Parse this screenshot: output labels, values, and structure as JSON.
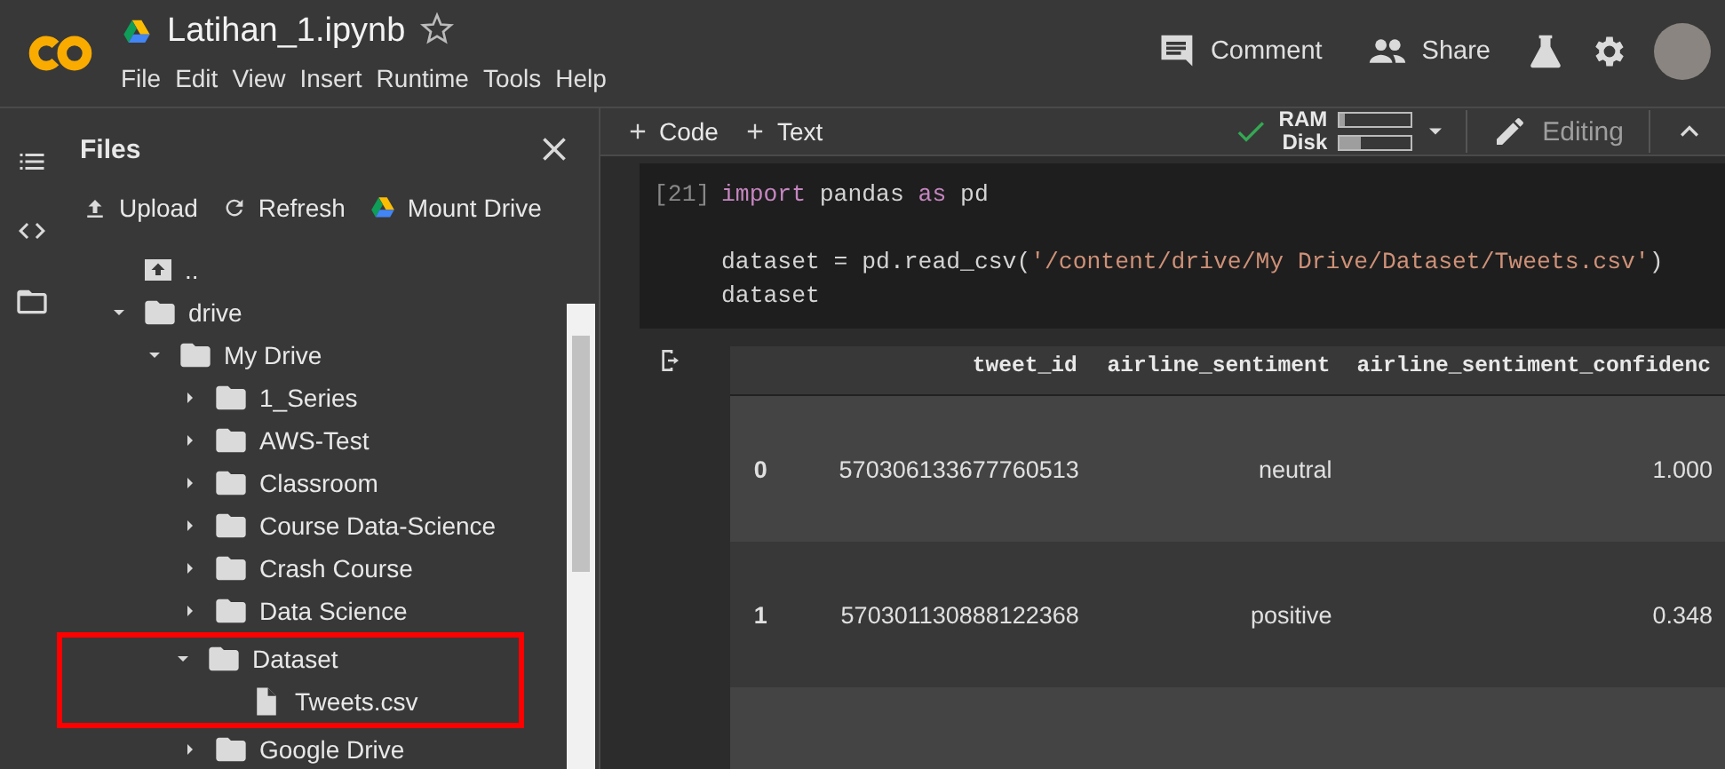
{
  "header": {
    "title": "Latihan_1.ipynb",
    "starred": false,
    "menu": [
      "File",
      "Edit",
      "View",
      "Insert",
      "Runtime",
      "Tools",
      "Help"
    ],
    "actions": [
      {
        "kind": "comment",
        "label": "Comment"
      },
      {
        "kind": "share",
        "label": "Share"
      }
    ]
  },
  "sidebar": {
    "title": "Files",
    "actions": [
      {
        "kind": "upload",
        "label": "Upload"
      },
      {
        "kind": "refresh",
        "label": "Refresh"
      },
      {
        "kind": "drive",
        "label": "Mount Drive"
      }
    ],
    "tree": [
      {
        "kind": "parent",
        "name": ".."
      },
      {
        "kind": "folder",
        "name": "drive",
        "expanded": true,
        "children": [
          {
            "kind": "folder",
            "name": "My Drive",
            "expanded": true,
            "children": [
              {
                "kind": "folder",
                "name": "1_Series",
                "expanded": false,
                "highlighted": false
              },
              {
                "kind": "folder",
                "name": "AWS-Test",
                "expanded": false,
                "highlighted": false
              },
              {
                "kind": "folder",
                "name": "Classroom",
                "expanded": false,
                "highlighted": false
              },
              {
                "kind": "folder",
                "name": "Course Data-Science",
                "expanded": false,
                "highlighted": false
              },
              {
                "kind": "folder",
                "name": "Crash Course",
                "expanded": false,
                "highlighted": false
              },
              {
                "kind": "folder",
                "name": "Data Science",
                "expanded": false,
                "highlighted": false
              },
              {
                "kind": "folder",
                "name": "Dataset",
                "expanded": true,
                "highlighted": true,
                "children": [
                  {
                    "kind": "file",
                    "name": "Tweets.csv"
                  }
                ]
              },
              {
                "kind": "folder",
                "name": "Google Drive",
                "expanded": false,
                "highlighted": false
              }
            ]
          }
        ]
      }
    ]
  },
  "toolbar": {
    "add": [
      "Code",
      "Text"
    ],
    "connected": true,
    "resources": [
      {
        "name": "RAM",
        "level": 0.08
      },
      {
        "name": "Disk",
        "level": 0.3
      }
    ],
    "mode": "Editing"
  },
  "cell": {
    "count": "[21]",
    "lines": [
      {
        "kind": "code",
        "tokens": [
          {
            "kind": "keyword",
            "text": "import"
          },
          {
            "kind": "plain",
            "text": " pandas "
          },
          {
            "kind": "keyword",
            "text": "as"
          },
          {
            "kind": "plain",
            "text": " pd"
          }
        ]
      },
      {
        "kind": "blank"
      },
      {
        "kind": "code",
        "tokens": [
          {
            "kind": "plain",
            "text": "dataset = pd.read_csv("
          },
          {
            "kind": "string",
            "text": "'/content/drive/My Drive/Dataset/Tweets.csv'"
          },
          {
            "kind": "plain",
            "text": ")"
          }
        ]
      },
      {
        "kind": "code",
        "tokens": [
          {
            "kind": "plain",
            "text": "dataset"
          }
        ]
      }
    ]
  },
  "table": {
    "columns": [
      "tweet_id",
      "airline_sentiment",
      "airline_sentiment_confidenc"
    ],
    "rows": [
      {
        "kind": "data",
        "index": "0",
        "cells": [
          "570306133677760513",
          "neutral",
          "1.000"
        ]
      },
      {
        "kind": "data",
        "index": "1",
        "cells": [
          "570301130888122368",
          "positive",
          "0.348"
        ]
      },
      {
        "kind": "cut-off"
      }
    ]
  }
}
